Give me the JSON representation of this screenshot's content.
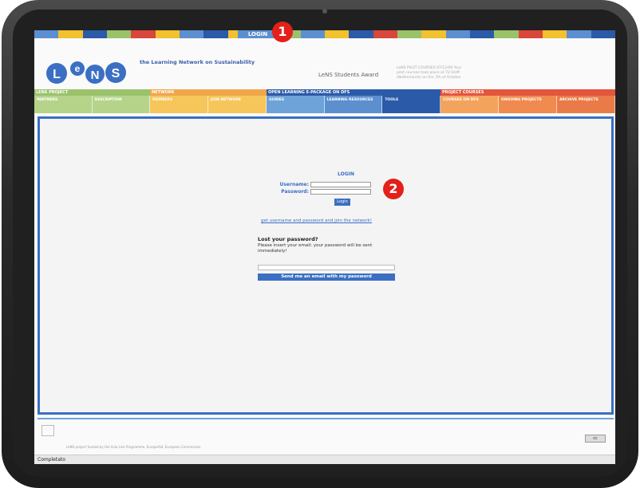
{
  "topbar": {
    "login_label": "LOGIN"
  },
  "markers": {
    "one": "1",
    "two": "2"
  },
  "header": {
    "logo_text": "LeNS",
    "tagline": "the Learning Network on Sustainability",
    "award": "LeNS Students Award",
    "pilot_text": "LeNS PILOT COURSES 07/12/09 Your pilot courses took place at TU Delft (Netherlands) on the 7th of October"
  },
  "nav": {
    "groups": [
      {
        "title": "LENS PROJECT",
        "items": [
          "PARTNERS",
          "DESCRIPTION"
        ]
      },
      {
        "title": "NETWORK",
        "items": [
          "MEMBERS",
          "JOIN NETWORK"
        ]
      },
      {
        "title": "OPEN LEARNING E-PACKAGE ON DFS",
        "items": [
          "GUIDES",
          "LEARNING RESOURCES",
          "TOOLS"
        ]
      },
      {
        "title": "PROJECT COURSES",
        "items": [
          "COURSES ON DFS",
          "ONGOING PROJECTS",
          "ARCHIVE PROJECTS"
        ]
      }
    ]
  },
  "login": {
    "heading": "LOGIN",
    "username_label": "Username:",
    "password_label": "Password:",
    "button": "Login",
    "join_link": "get username and password and join the network!"
  },
  "lost": {
    "heading": "Lost your password?",
    "text": "Please insert your email: your password will be sent immediately!",
    "button": "Send me an email with my password"
  },
  "footer": {
    "funding": "LeNS project funded by the Asia Link Programme, EuropeAid, European Commission",
    "cc": "cc"
  },
  "status": {
    "text": "Completato"
  },
  "colors": {
    "accent": "#3a6fc4",
    "marker": "#e32019"
  }
}
